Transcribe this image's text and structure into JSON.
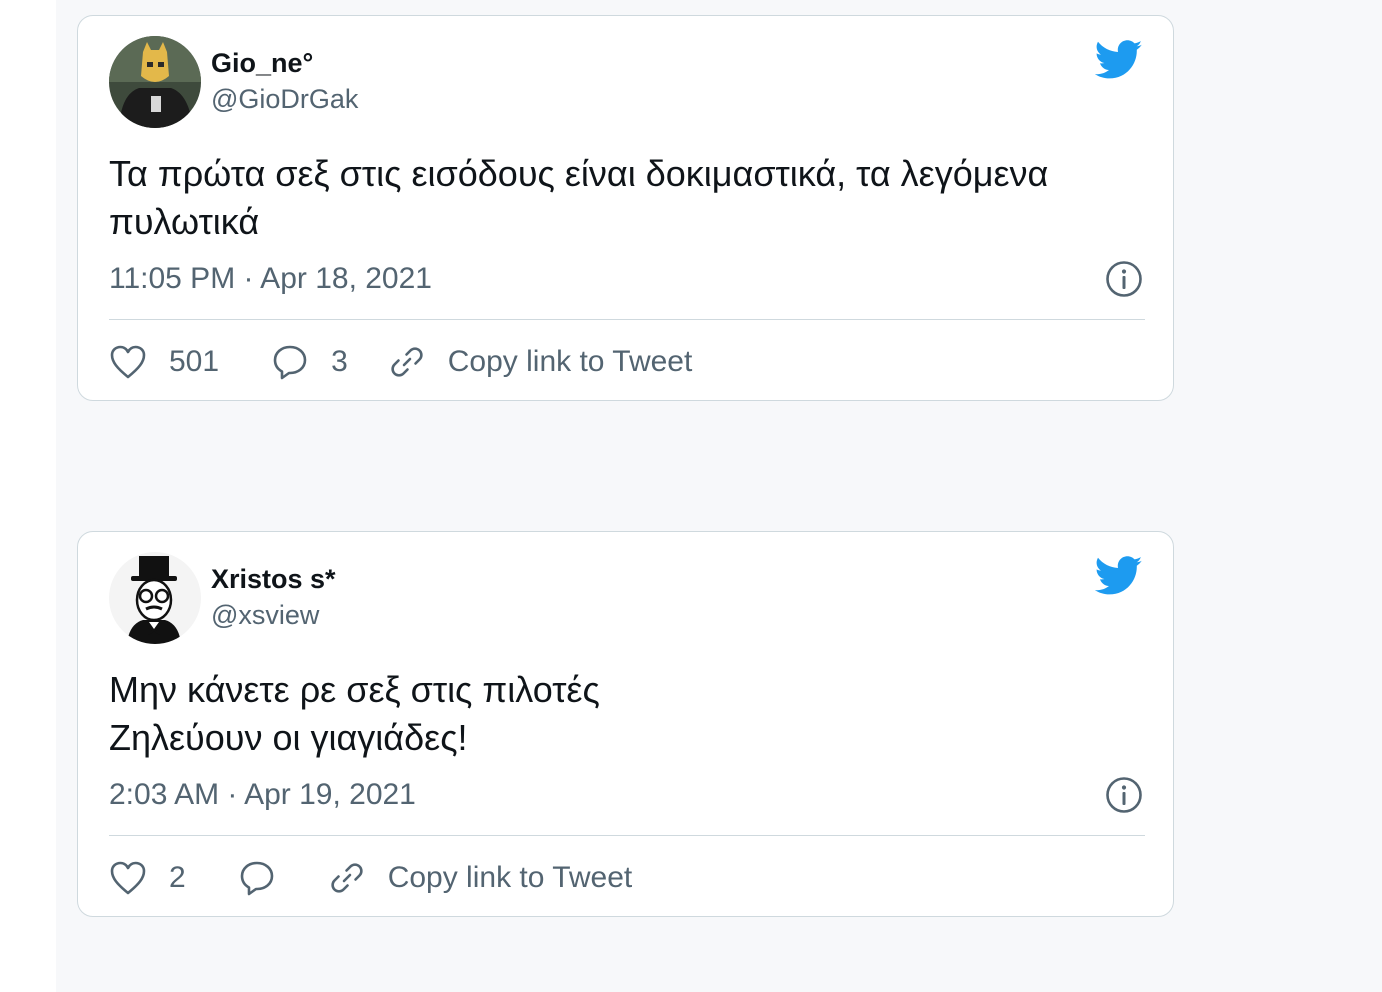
{
  "tweets": [
    {
      "author_name": "Gio_ne°",
      "author_handle": "@GioDrGak",
      "text_lines": [
        "Τα πρώτα σεξ στις εισόδους είναι δοκιμαστικά, τα λεγόμενα",
        "πυλωτικά"
      ],
      "timestamp": "11:05 PM · Apr 18, 2021",
      "like_count": "501",
      "reply_count": "3",
      "copy_link_label": "Copy link to Tweet",
      "avatar_icon": "avatar-photo-masked-person"
    },
    {
      "author_name": "Xristos s*",
      "author_handle": "@xsview",
      "text_lines": [
        "Μην κάνετε ρε σεξ στις πιλοτές",
        "Ζηλεύουν οι γιαγιάδες!"
      ],
      "timestamp": "2:03 AM · Apr 19, 2021",
      "like_count": "2",
      "reply_count": "",
      "copy_link_label": "Copy link to Tweet",
      "avatar_icon": "avatar-illustration-top-hat-man"
    }
  ],
  "icons": {
    "brand": "twitter-bird-icon",
    "info": "info-icon",
    "like": "heart-icon",
    "reply": "speech-bubble-icon",
    "copy": "link-icon"
  },
  "colors": {
    "twitter_blue": "#1d9bf0",
    "text_primary": "#0f1419",
    "text_secondary": "#536471",
    "border": "#cfd9de",
    "page_background": "#f7f8fa"
  }
}
